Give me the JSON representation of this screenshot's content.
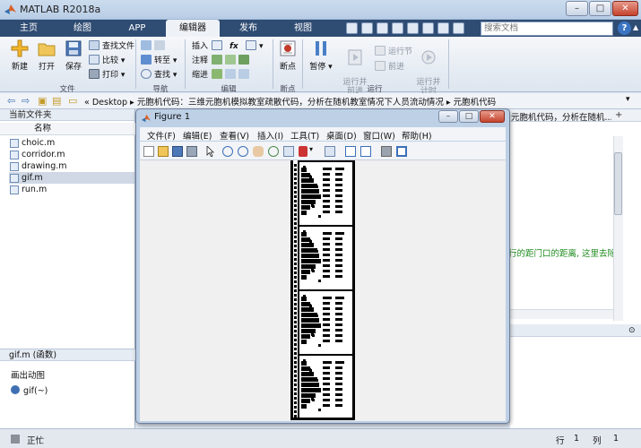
{
  "window": {
    "title": "MATLAB R2018a",
    "minimize": "–",
    "maximize": "□",
    "close": "✕"
  },
  "tabs": [
    {
      "label": "主页"
    },
    {
      "label": "绘图"
    },
    {
      "label": "APP"
    },
    {
      "label": "编辑器",
      "active": true
    },
    {
      "label": "发布"
    },
    {
      "label": "视图"
    }
  ],
  "search": {
    "placeholder": "搜索文档"
  },
  "help": "?",
  "ribbon": {
    "file": {
      "group_label": "文件",
      "new": "新建",
      "open": "打开",
      "save": "保存",
      "find_files": "查找文件",
      "compare": "比较",
      "print": "打印"
    },
    "navigate": {
      "group_label": "导航",
      "goto": "转至",
      "find": "查找"
    },
    "edit": {
      "group_label": "编辑",
      "insert": "插入",
      "comment": "注释",
      "indent": "缩进",
      "fx": "fx"
    },
    "breakpoints": {
      "group_label": "断点",
      "breakpoint": "断点"
    },
    "run": {
      "group_label": "运行",
      "pause": "暂停",
      "run_advance": "运行并\n前进",
      "run_section": "运行节",
      "advance": "前进",
      "run_time": "运行并\n计时"
    }
  },
  "address": {
    "path": "«  Desktop  ▸  元胞机代码：三维元胞机模拟教室疏散代码，分析在随机教室情况下人员流动情况  ▸  元胞机代码"
  },
  "current_folder": {
    "header": "当前文件夹",
    "column_name": "名称",
    "files": [
      {
        "name": "choic.m"
      },
      {
        "name": "corridor.m"
      },
      {
        "name": "drawing.m"
      },
      {
        "name": "gif.m",
        "selected": true
      },
      {
        "name": "run.m"
      }
    ]
  },
  "details": {
    "header": "gif.m  (函数)",
    "line1": "画出动图",
    "line2": "gif(~)"
  },
  "editor": {
    "tab_text": "元胞机代码，分析在随机...",
    "code_fragment": "行的距门口的距离, 这里去除",
    "plus": "+"
  },
  "figure": {
    "title": "Figure 1",
    "menus": [
      "文件(F)",
      "编辑(E)",
      "查看(V)",
      "插入(I)",
      "工具(T)",
      "桌面(D)",
      "窗口(W)",
      "帮助(H)"
    ]
  },
  "status": {
    "text": "正忙",
    "line_label": "行",
    "line_value": "1",
    "col_label": "列",
    "col_value": "1"
  },
  "colors": {
    "accent": "#2f4c73",
    "selected_row": "#cfd8e4",
    "code_comment": "#1c8a1c"
  }
}
